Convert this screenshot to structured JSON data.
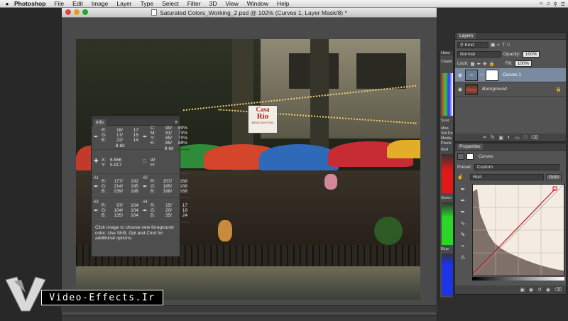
{
  "menubar": {
    "app_name": "Photoshop",
    "items": [
      "File",
      "Edit",
      "Image",
      "Layer",
      "Type",
      "Select",
      "Filter",
      "3D",
      "View",
      "Window",
      "Help"
    ]
  },
  "document": {
    "title": "Saturated Colors_Working_2.psd @ 102% (Curves 1, Layer Mask/8) *"
  },
  "photo": {
    "sign_line1": "Casa",
    "sign_line2": "Rio",
    "sign_line3": "MEXICAN FOOD"
  },
  "info": {
    "tab": "Info",
    "cells": [
      {
        "lines": [
          {
            "l": "R:",
            "a": "16/",
            "b": "17"
          },
          {
            "l": "G:",
            "a": "17/",
            "b": "15"
          },
          {
            "l": "B:",
            "a": "22/",
            "b": "14"
          }
        ],
        "bit": "8-bit"
      },
      {
        "lines": [
          {
            "l": "C:",
            "a": "90/",
            "b": "80%"
          },
          {
            "l": "M:",
            "a": "81/",
            "b": "73%"
          },
          {
            "l": "Y:",
            "a": "65/",
            "b": "70%"
          },
          {
            "l": "K:",
            "a": "85/",
            "b": "89%"
          }
        ],
        "bit": "8-bit"
      },
      {
        "lines": [
          {
            "l": "X:",
            "a": "6.566",
            "b": ""
          },
          {
            "l": "Y:",
            "a": "5.917",
            "b": ""
          }
        ],
        "bit": ""
      },
      {
        "lines": [
          {
            "l": "W:",
            "a": "",
            "b": ""
          },
          {
            "l": "H:",
            "a": "",
            "b": ""
          }
        ],
        "bit": ""
      },
      {
        "id": "#1",
        "lines": [
          {
            "l": "R:",
            "a": "177/",
            "b": "192"
          },
          {
            "l": "G:",
            "a": "214/",
            "b": "195"
          },
          {
            "l": "B:",
            "a": "239/",
            "b": "198"
          }
        ],
        "bit": ""
      },
      {
        "id": "#2",
        "lines": [
          {
            "l": "R:",
            "a": "157/",
            "b": "168"
          },
          {
            "l": "G:",
            "a": "185/",
            "b": "168"
          },
          {
            "l": "B:",
            "a": "198/",
            "b": "168"
          }
        ],
        "bit": ""
      },
      {
        "id": "#3",
        "lines": [
          {
            "l": "R:",
            "a": "97/",
            "b": "104"
          },
          {
            "l": "G:",
            "a": "104/",
            "b": "104"
          },
          {
            "l": "B:",
            "a": "135/",
            "b": "104"
          }
        ],
        "bit": ""
      },
      {
        "id": "#4",
        "lines": [
          {
            "l": "R:",
            "a": "15/",
            "b": "17"
          },
          {
            "l": "G:",
            "a": "20/",
            "b": "18"
          },
          {
            "l": "B:",
            "a": "35/",
            "b": "24"
          }
        ],
        "bit": ""
      }
    ],
    "hint": "Click image to choose new foreground color. Use Shift, Opt and Cmd for additional options."
  },
  "histogram": {
    "label": "Histo",
    "channels_label": "Chann",
    "source_label": "Sour",
    "stats": [
      "Mea",
      "Std De",
      "Media",
      "Pixels"
    ],
    "red_label": "Red",
    "green_label": "Green",
    "blue_label": "Blue"
  },
  "layers": {
    "tab": "Layers",
    "kind_label": "Kind",
    "blend_mode": "Normal",
    "opacity_label": "Opacity:",
    "opacity_value": "100%",
    "lock_label": "Lock:",
    "fill_label": "Fill:",
    "fill_value": "100%",
    "items": [
      {
        "name": "Curves 1"
      },
      {
        "name": "Background"
      }
    ]
  },
  "properties": {
    "tab": "Properties",
    "panel_title": "Curves",
    "preset_label": "Preset:",
    "preset_value": "Custom",
    "channel_value": "Red",
    "auto_label": "Auto"
  },
  "watermark": {
    "text": "Video-Effects.Ir"
  },
  "colors": {
    "panel_bg": "#535353",
    "selected_layer": "#7a8aa0",
    "curve_line": "#c01818"
  }
}
